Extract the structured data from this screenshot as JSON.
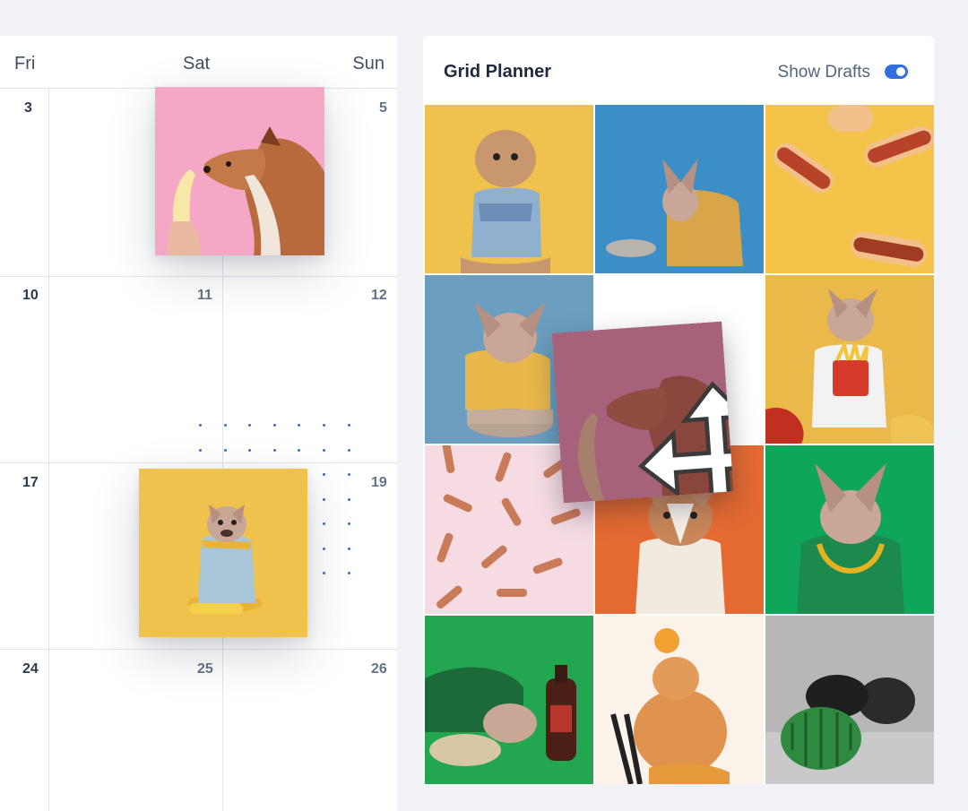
{
  "calendar": {
    "days": [
      "Fri",
      "Sat",
      "Sun"
    ],
    "dates": {
      "row1": [
        "3",
        "5"
      ],
      "row2": [
        "10",
        "11",
        "12"
      ],
      "row3": [
        "17",
        "19"
      ],
      "row4": [
        "24",
        "25",
        "26"
      ]
    },
    "photos": [
      "dog-with-banana-photo",
      "french-bulldog-yellow-photo"
    ]
  },
  "planner": {
    "title": "Grid Planner",
    "drafts_label": "Show Drafts",
    "drafts_toggle_on": true,
    "accent": "#2f6fde",
    "tiles": [
      "poodle-mix-yellow",
      "frenchie-blue",
      "hotdogs-yellow",
      "frenchie-bowl-blue",
      "frenchie-fries-yellow",
      "bone-cookies-pink",
      "corgi-orange",
      "frenchie-green-chain",
      "frenchie-chocolate-green",
      "pomeranian-orange-hat",
      "terrier-watermelon"
    ],
    "drag_icon": "move-icon"
  }
}
